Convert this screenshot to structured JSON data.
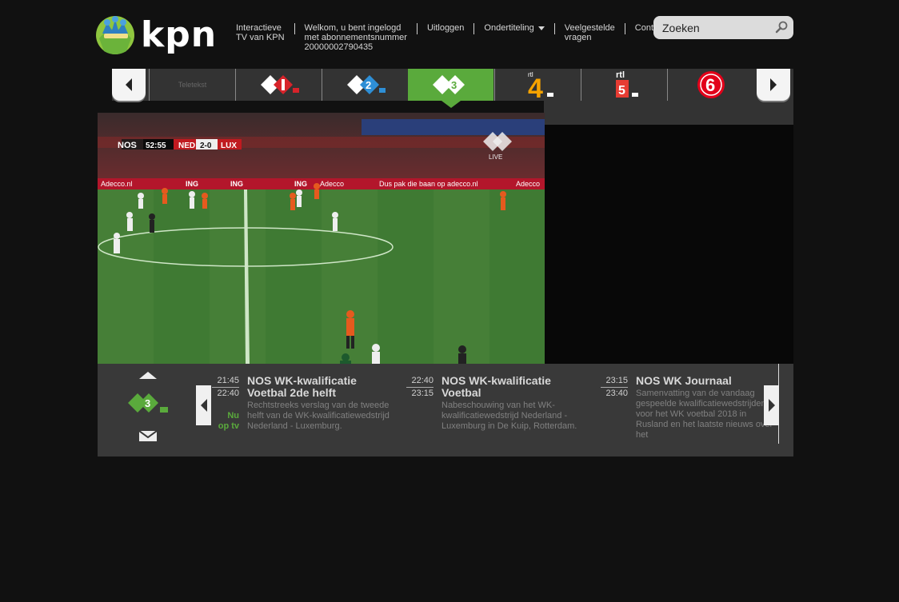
{
  "brand": {
    "name": "kpn"
  },
  "nav": {
    "items": [
      {
        "label_1": "Interactieve",
        "label_2": "TV van KPN"
      },
      {
        "label_1": "Welkom, u bent ingelogd",
        "label_2": "met abonnementsnummer",
        "label_3": "20000002790435"
      },
      {
        "label_1": "Uitloggen"
      },
      {
        "label_1": "Ondertiteling"
      },
      {
        "label_1": "Veelgestelde",
        "label_2": "vragen"
      },
      {
        "label_1": "Contact"
      }
    ]
  },
  "search": {
    "placeholder": "Zoeken",
    "icon": "magnifier-icon"
  },
  "channels": [
    {
      "name": "Teletekst",
      "icon": "teletekst-logo"
    },
    {
      "name": "NPO 1 HD",
      "icon": "npo1-logo",
      "color": "#d7232a"
    },
    {
      "name": "NPO 2 HD",
      "icon": "npo2-logo",
      "color": "#2e8fd6"
    },
    {
      "name": "NPO 3 HD",
      "icon": "npo3-logo",
      "color": "#5aaa3c",
      "active": true
    },
    {
      "name": "RTL 4",
      "icon": "rtl4-logo",
      "color": "#f6a300"
    },
    {
      "name": "RTL 5",
      "icon": "rtl5-logo",
      "color": "#e73c33"
    },
    {
      "name": "SBS 6",
      "icon": "sbs6-logo",
      "color": "#e2001a"
    }
  ],
  "video": {
    "broadcaster": "NOS",
    "clock": "52:55",
    "home": "NED",
    "score": "2-0",
    "away": "LUX",
    "live_label": "LIVE",
    "banners": [
      "Adecco.nl",
      "ING",
      "ING",
      "ING",
      "Adecco",
      "Dus pak die baan op adecco.nl",
      "Adecco"
    ]
  },
  "epg": {
    "programs": [
      {
        "start": "21:45",
        "end": "22:40",
        "title": "NOS WK-kwalificatie Voetbal 2de helft",
        "description": "Rechtstreeks verslag van de tweede helft van de WK-kwalificatiewedstrijd Nederland - Luxemburg.",
        "now_label_1": "Nu",
        "now_label_2": "op tv"
      },
      {
        "start": "22:40",
        "end": "23:15",
        "title": "NOS WK-kwalificatie Voetbal",
        "description": "Nabeschouwing van het WK-kwalificatiewedstrijd Nederland - Luxemburg in De Kuip, Rotterdam."
      },
      {
        "start": "23:15",
        "end": "23:40",
        "title": "NOS WK Journaal",
        "description": "Samenvatting van de vandaag gespeelde kwalificatiewedstrijden voor het WK voetbal 2018 in Rusland en het laatste nieuws over het"
      }
    ]
  }
}
